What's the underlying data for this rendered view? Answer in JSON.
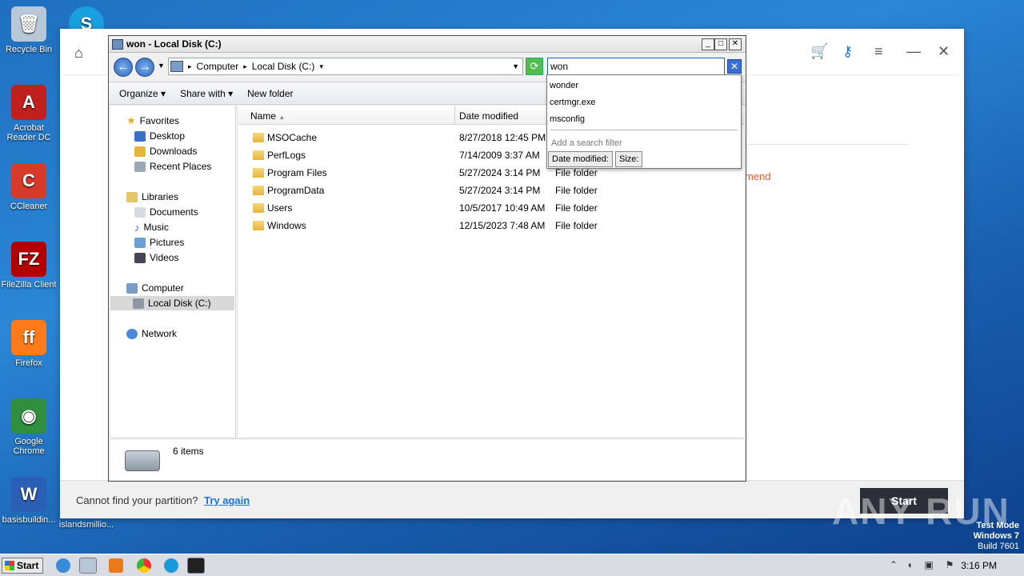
{
  "desktop": {
    "icons": [
      {
        "label": "Recycle Bin",
        "color": "#b8c8d8",
        "glyph": "🗑"
      },
      {
        "label": "Acrobat Reader DC",
        "color": "#c0201e",
        "glyph": "A"
      },
      {
        "label": "CCleaner",
        "color": "#d63a2a",
        "glyph": "C"
      },
      {
        "label": "FileZilla Client",
        "color": "#b40000",
        "glyph": "FZ"
      },
      {
        "label": "Firefox",
        "color": "#ff7a1a",
        "glyph": "ff"
      },
      {
        "label": "Google Chrome",
        "color": "#2f8f3f",
        "glyph": "◉"
      },
      {
        "label": "basisbuildin...",
        "color": "#2b5fb6",
        "glyph": "W"
      }
    ],
    "right_icons": [
      {
        "label": "islandsmillio...",
        "color": "#1aa0e0",
        "glyph": "S"
      }
    ]
  },
  "app": {
    "recommend_text": "mend",
    "footer_message": "Cannot find your partition?",
    "footer_link": "Try again",
    "start_button": "Start"
  },
  "explorer": {
    "title": "won - Local Disk (C:)",
    "address": {
      "segments": [
        "Computer",
        "Local Disk (C:)"
      ]
    },
    "search_value": "won",
    "toolbar": {
      "organize": "Organize",
      "share": "Share with",
      "new_folder": "New folder"
    },
    "nav": {
      "favorites": "Favorites",
      "desktop": "Desktop",
      "downloads": "Downloads",
      "recent": "Recent Places",
      "libraries": "Libraries",
      "documents": "Documents",
      "music": "Music",
      "pictures": "Pictures",
      "videos": "Videos",
      "computer": "Computer",
      "local_disk": "Local Disk (C:)",
      "network": "Network"
    },
    "columns": {
      "name": "Name",
      "date": "Date modified"
    },
    "files": [
      {
        "name": "MSOCache",
        "date": "8/27/2018 12:45 PM",
        "type": ""
      },
      {
        "name": "PerfLogs",
        "date": "7/14/2009 3:37 AM",
        "type": ""
      },
      {
        "name": "Program Files",
        "date": "5/27/2024 3:14 PM",
        "type": "File folder"
      },
      {
        "name": "ProgramData",
        "date": "5/27/2024 3:14 PM",
        "type": "File folder"
      },
      {
        "name": "Users",
        "date": "10/5/2017 10:49 AM",
        "type": "File folder"
      },
      {
        "name": "Windows",
        "date": "12/15/2023 7:48 AM",
        "type": "File folder"
      }
    ],
    "status": "6 items",
    "dropdown": {
      "suggestions": [
        "wonder",
        "certmgr.exe",
        "msconfig"
      ],
      "filter_placeholder": "Add a search filter",
      "filters": [
        "Date modified:",
        "Size:"
      ]
    }
  },
  "taskbar": {
    "start": "Start",
    "time": "3:16 PM"
  },
  "watermark": {
    "line1": "Test Mode",
    "line2": "Windows 7",
    "line3": "Build 7601",
    "brand": "ANY RUN"
  }
}
